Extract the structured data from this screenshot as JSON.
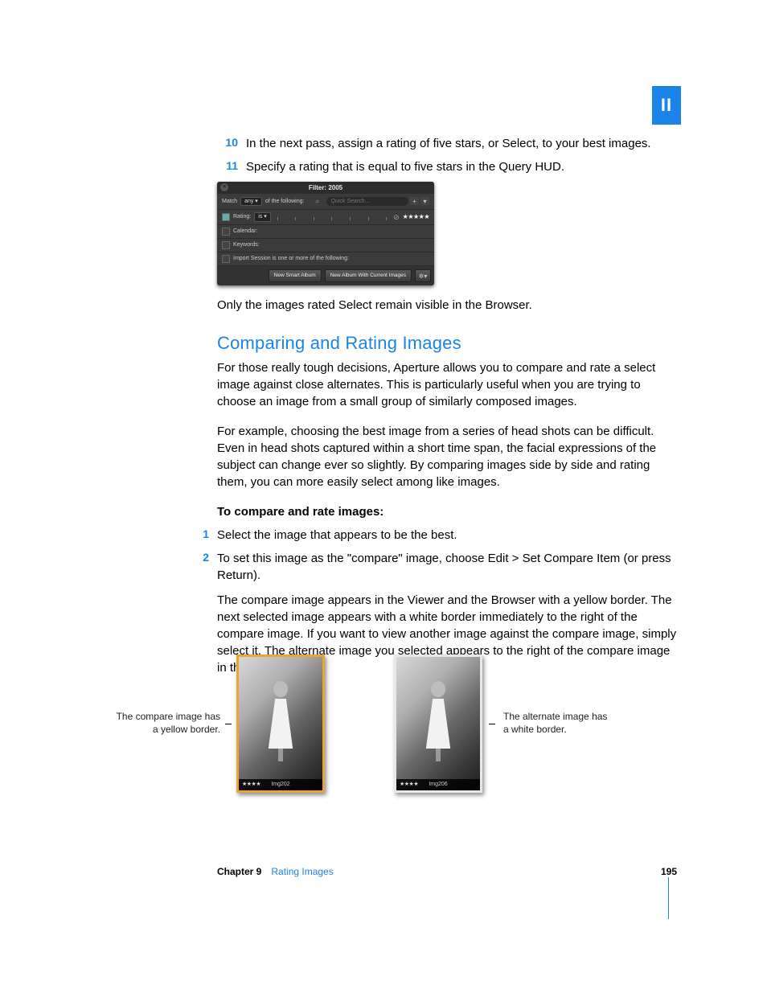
{
  "partBadge": "II",
  "steps1": [
    {
      "num": "10",
      "text": "In the next pass, assign a rating of five stars, or Select, to your best images."
    },
    {
      "num": "11",
      "text": "Specify a rating that is equal to five stars in the Query HUD."
    }
  ],
  "hud": {
    "title": "Filter: 2005",
    "match": "Match",
    "any": "any",
    "ofFollowing": "of the following:",
    "searchPlaceholder": "Quick Search…",
    "ratingLabel": "Rating:",
    "ratingOp": "is",
    "stars": "★★★★★",
    "calendar": "Calendar:",
    "keywords": "Keywords:",
    "importSession": "Import Session is one or more of the following:",
    "btnSmart": "New Smart Album",
    "btnAlbum": "New Album With Current Images"
  },
  "afterHud": "Only the images rated Select remain visible in the Browser.",
  "heading": "Comparing and Rating Images",
  "p1": "For those really tough decisions, Aperture allows you to compare and rate a select image against close alternates. This is particularly useful when you are trying to choose an image from a small group of similarly composed images.",
  "p2": "For example, choosing the best image from a series of head shots can be difficult. Even in head shots captured within a short time span, the facial expressions of the subject can change ever so slightly. By comparing images side by side and rating them, you can more easily select among like images.",
  "subhead": "To compare and rate images:",
  "steps2": [
    {
      "num": "1",
      "text": "Select the image that appears to be the best."
    },
    {
      "num": "2",
      "text": "To set this image as the \"compare\" image, choose Edit > Set Compare Item (or press Return)."
    }
  ],
  "p3": "The compare image appears in the Viewer and the Browser with a yellow border. The next selected image appears with a white border immediately to the right of the compare image. If you want to view another image against the compare image, simply select it. The alternate image you selected appears to the right of the compare image in the Viewer.",
  "callouts": {
    "left1": "The compare image has",
    "left2": "a yellow border.",
    "right1": "The alternate image has",
    "right2": "a white border."
  },
  "thumbs": {
    "compare": {
      "stars": "★★★★",
      "label": "Img202"
    },
    "alt": {
      "stars": "★★★★",
      "label": "Img206"
    }
  },
  "footer": {
    "chapter": "Chapter 9",
    "title": "Rating Images",
    "page": "195"
  }
}
